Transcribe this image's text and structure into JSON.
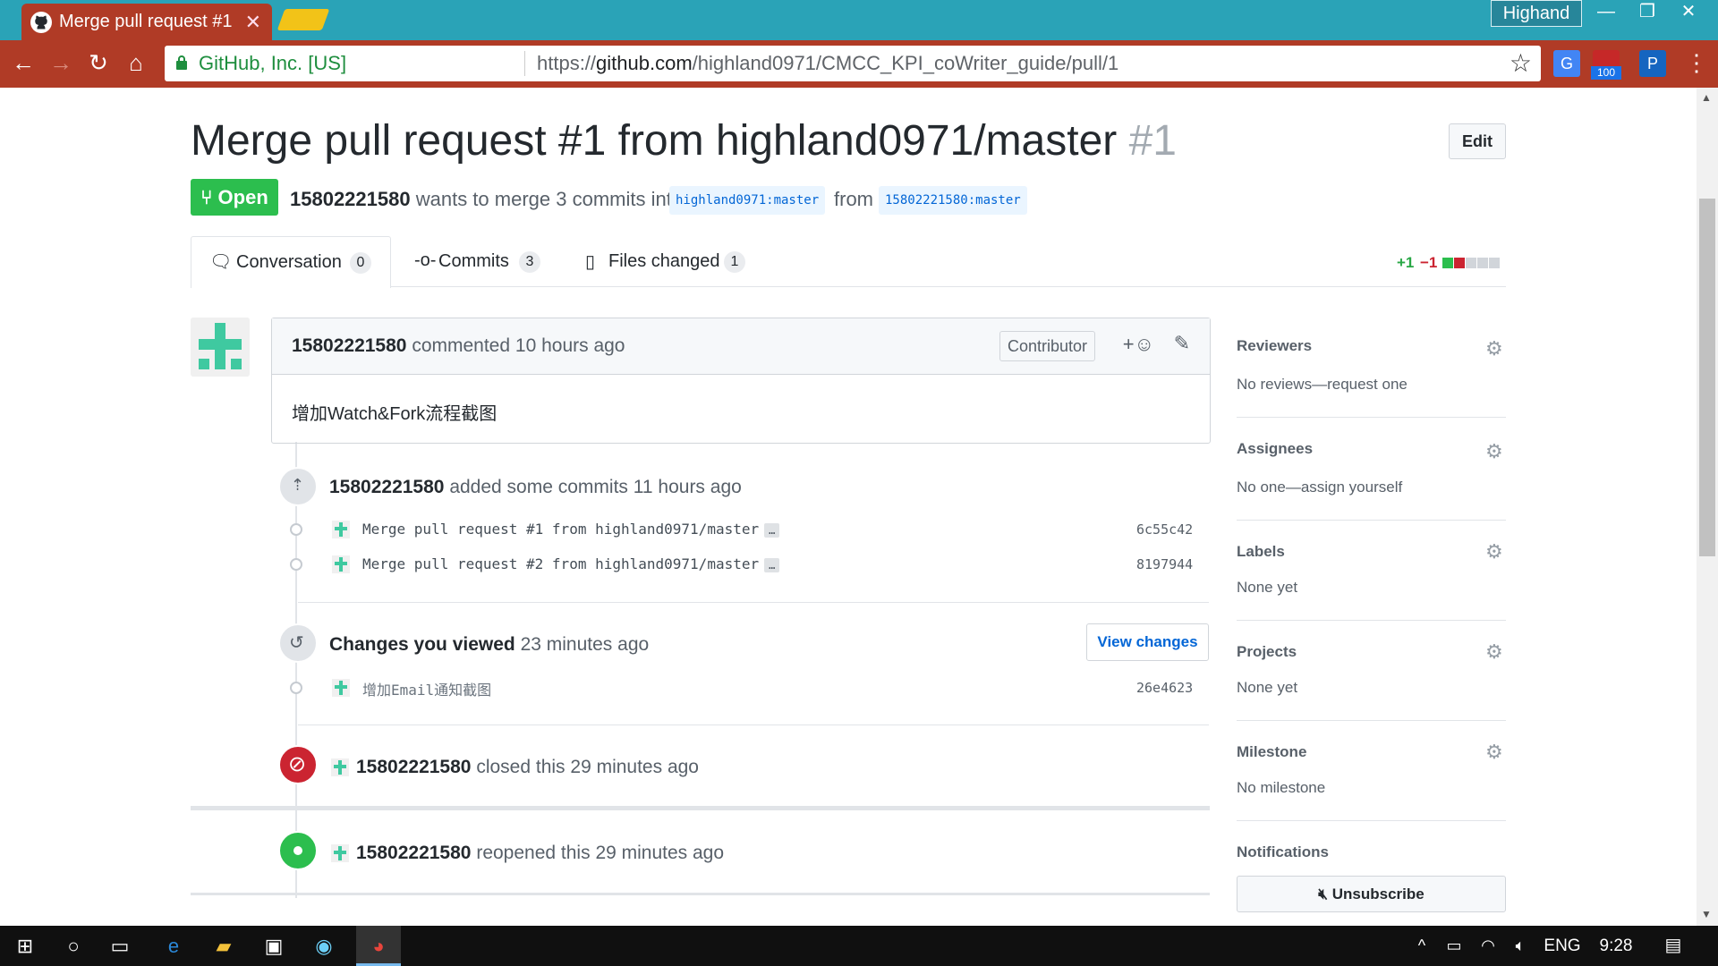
{
  "browser": {
    "tab_title": "Merge pull request #1",
    "profile_name": "Highand",
    "security_label": "GitHub, Inc. [US]",
    "url_scheme": "https://",
    "url_host": "github.com",
    "url_path": "/highland0971/CMCC_KPI_coWriter_guide/pull/1",
    "extension_badge": "100",
    "colors": {
      "tabstrip": "#2aa3b7",
      "toolbar": "#b03b26"
    }
  },
  "pr": {
    "title": "Merge pull request #1 from highland0971/master",
    "number": "#1",
    "edit_label": "Edit",
    "state_label": "Open",
    "author": "15802221580",
    "meta_text": "wants to merge 3 commits into",
    "base_branch": "highland0971:master",
    "from_text": "from",
    "head_branch": "15802221580:master"
  },
  "tabs": [
    {
      "label": "Conversation",
      "count": "0"
    },
    {
      "label": "Commits",
      "count": "3"
    },
    {
      "label": "Files changed",
      "count": "1"
    }
  ],
  "diffstat": {
    "additions": "+1",
    "deletions": "−1"
  },
  "comment": {
    "author": "15802221580",
    "action": "commented",
    "time": "10 hours ago",
    "role": "Contributor",
    "body": "增加Watch&Fork流程截图"
  },
  "events": {
    "commits_added": {
      "author": "15802221580",
      "text": "added some commits",
      "time": "11 hours ago"
    },
    "commits": [
      {
        "message": "Merge pull request #1 from highland0971/master",
        "sha": "6c55c42"
      },
      {
        "message": "Merge pull request #2 from highland0971/master",
        "sha": "8197944"
      }
    ],
    "viewed": {
      "text": "Changes you viewed",
      "time": "23 minutes ago",
      "button": "View changes"
    },
    "viewed_commit": {
      "message": "增加Email通知截图",
      "sha": "26e4623"
    },
    "closed": {
      "author": "15802221580",
      "text": "closed this",
      "time": "29 minutes ago"
    },
    "reopened": {
      "author": "15802221580",
      "text": "reopened this",
      "time": "29 minutes ago"
    },
    "commit_dots": "…"
  },
  "sidebar": {
    "reviewers": {
      "title": "Reviewers",
      "value": "No reviews—request one"
    },
    "assignees": {
      "title": "Assignees",
      "value": "No one—assign yourself"
    },
    "labels": {
      "title": "Labels",
      "value": "None yet"
    },
    "projects": {
      "title": "Projects",
      "value": "None yet"
    },
    "milestone": {
      "title": "Milestone",
      "value": "No milestone"
    },
    "notifications": {
      "title": "Notifications",
      "button": "Unsubscribe"
    }
  },
  "taskbar": {
    "lang": "ENG",
    "time": "9:28"
  }
}
